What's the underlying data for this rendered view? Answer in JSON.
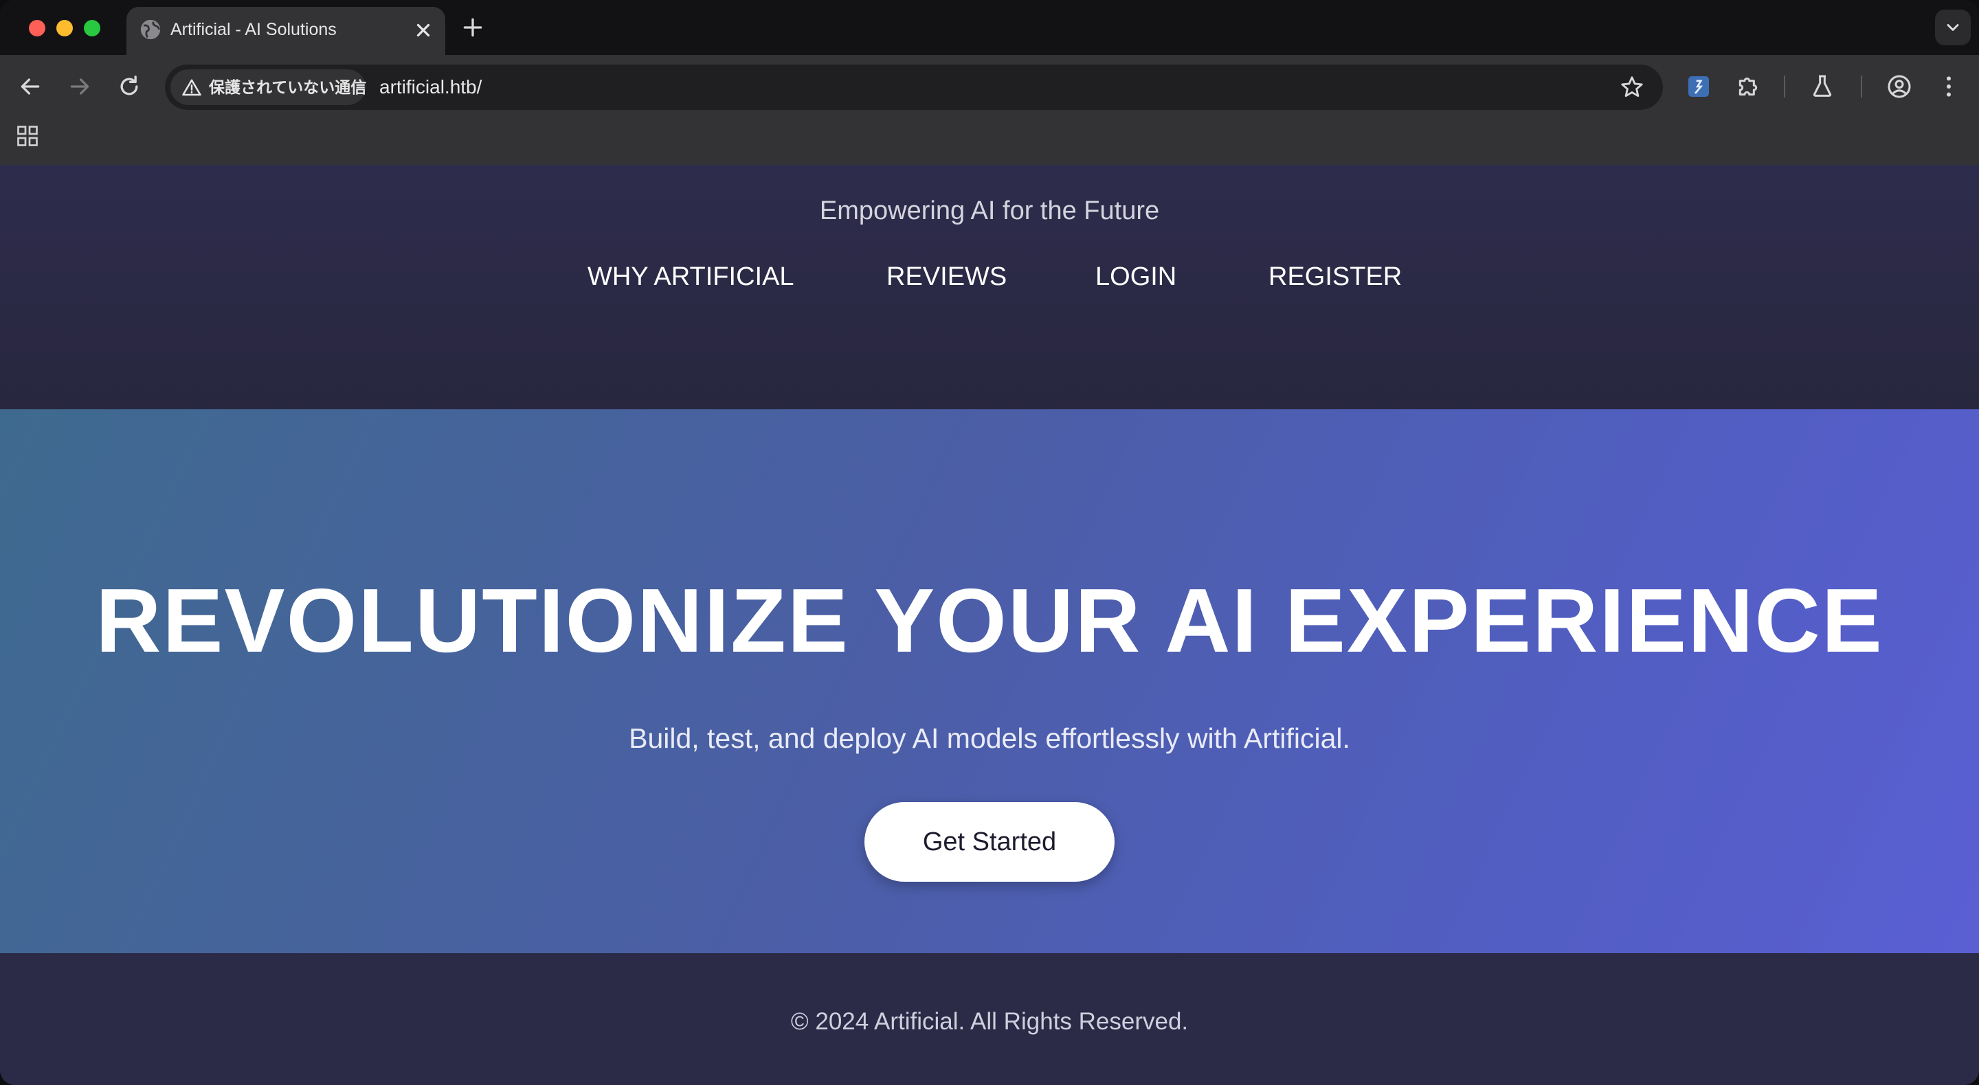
{
  "browser": {
    "tab": {
      "title": "Artificial - AI Solutions"
    },
    "address_bar": {
      "security_label": "保護されていない通信",
      "url": "artificial.htb/"
    }
  },
  "site": {
    "tagline": "Empowering AI for the Future",
    "nav": [
      {
        "label": "WHY ARTIFICIAL"
      },
      {
        "label": "REVIEWS"
      },
      {
        "label": "LOGIN"
      },
      {
        "label": "REGISTER"
      }
    ],
    "hero": {
      "title": "REVOLUTIONIZE YOUR AI EXPERIENCE",
      "subtitle": "Build, test, and deploy AI models effortlessly with Artificial.",
      "cta_label": "Get Started"
    },
    "footer": {
      "text": "© 2024 Artificial. All Rights Reserved."
    }
  },
  "colors": {
    "header_bg": "#2e2c4c",
    "hero_gradient_start": "#3f6a8f",
    "hero_gradient_end": "#5a5fd3",
    "cta_bg": "#ffffff"
  }
}
